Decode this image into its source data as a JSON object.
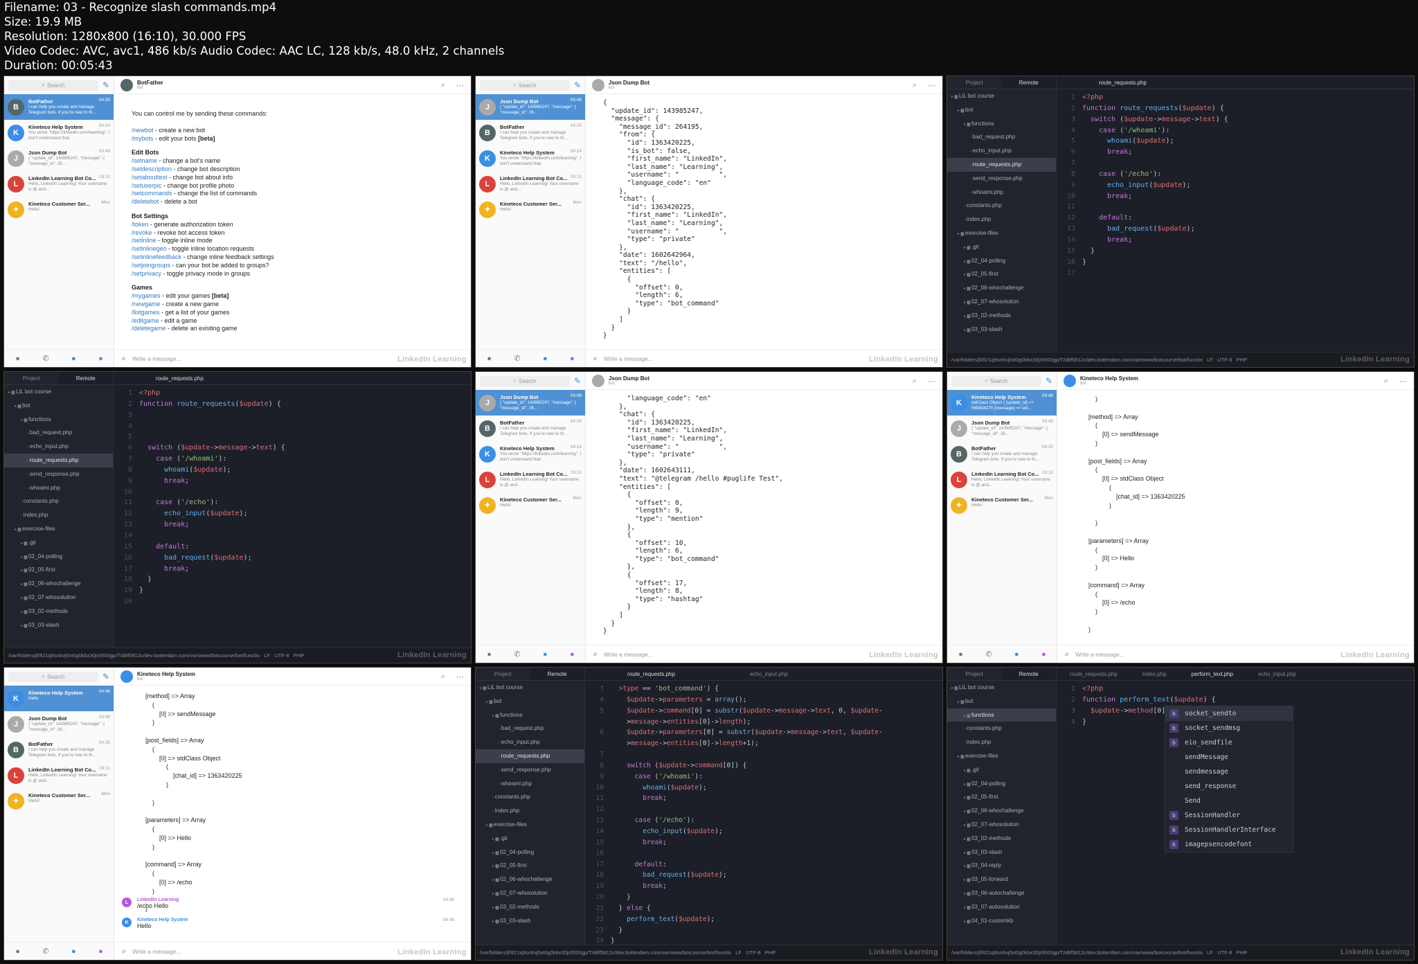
{
  "meta": {
    "filename": "Filename: 03 - Recognize slash commands.mp4",
    "size": "Size: 19.9 MB",
    "resolution": "Resolution: 1280x800 (16:10), 30.000 FPS",
    "video": "Video Codec: AVC, avc1, 486 kb/s Audio Codec: AAC LC, 128 kb/s, 48.0 kHz, 2 channels",
    "duration": "Duration: 00:05:43"
  },
  "common": {
    "search": "Search",
    "write": "Write a message...",
    "watermark": "LinkedIn Learning",
    "project": "Project",
    "remote": "Remote",
    "status_path": "/var/folders/jf/821q9sn6vj0xt0g0kbx30jr0000gp/T/d8f5812c/dev.botterdam.com/var/www/botcourse/bot/functio",
    "status_lf": "LF",
    "status_enc": "UTF-8",
    "status_lang": "PHP"
  },
  "chats": {
    "botfather": {
      "name": "BotFather",
      "preview": "I can help you create and manage Telegram bots. If you're new to th...",
      "time": "04:35"
    },
    "kineteco": {
      "name": "Kineteco Help System",
      "preview": "You wrote \"https://linkedin.com/learning\". I don't understand that.",
      "time": "04:14"
    },
    "jsondump": {
      "name": "Json Dump Bot",
      "preview": "{ \"update_id\": 143985247, \"message\": { \"message_id\": 26...",
      "time": "03:49"
    },
    "linkedin": {
      "name": "LinkedIn Learning Bot Co...",
      "preview": "Hello, LinkedIn Learning! Your username is @ and...",
      "time": "03:11"
    },
    "customer": {
      "name": "Kineteco Customer Ser...",
      "preview": "Hello!",
      "time": "Mon"
    },
    "stdclass": {
      "name": "Kineteco Help System",
      "preview": "stdClass Object ( [update_id] => 565834270 [message] => std...",
      "time": "04:48"
    },
    "hello": {
      "name": "Kineteco Help System",
      "preview": "Hello",
      "time": "04:48"
    }
  },
  "panel1": {
    "title": "BotFather",
    "subtitle": "bot",
    "intro": "You can control me by sending these commands:",
    "line1": [
      "/newbot",
      " - create a new bot"
    ],
    "line2": [
      "/mybots",
      " - edit your bots ",
      "[beta]"
    ],
    "edit_h": "Edit Bots",
    "edit": [
      [
        "/setname",
        " - change a bot's name"
      ],
      [
        "/setdescription",
        " - change bot description"
      ],
      [
        "/setabouttext",
        " - change bot about info"
      ],
      [
        "/setuserpic",
        " - change bot profile photo"
      ],
      [
        "/setcommands",
        " - change the list of commands"
      ],
      [
        "/deletebot",
        " - delete a bot"
      ]
    ],
    "settings_h": "Bot Settings",
    "settings": [
      [
        "/token",
        " - generate authorization token"
      ],
      [
        "/revoke",
        " - revoke bot access token"
      ],
      [
        "/setinline",
        " - toggle inline mode"
      ],
      [
        "/setinlinegeo",
        " - toggle inline location requests"
      ],
      [
        "/setinlinefeedback",
        " - change inline feedback settings"
      ],
      [
        "/setjoingroups",
        " - can your bot be added to groups?"
      ],
      [
        "/setprivacy",
        " - toggle privacy mode in groups"
      ]
    ],
    "games_h": "Games",
    "games": [
      [
        "/mygames",
        " - edit your games ",
        "[beta]"
      ],
      [
        "/newgame",
        " - create a new game"
      ],
      [
        "/listgames",
        " - get a list of your games"
      ],
      [
        "/editgame",
        " - edit a game"
      ],
      [
        "/deletegame",
        " - delete an existing game"
      ]
    ]
  },
  "panel2": {
    "title": "Json Dump Bot",
    "subtitle": "bot",
    "json": "{\n  \"update_id\": 143985247,\n  \"message\": {\n    \"message_id\": 264195,\n    \"from\": {\n      \"id\": 1363420225,\n      \"is_bot\": false,\n      \"first_name\": \"LinkedIn\",\n      \"last_name\": \"Learning\",\n      \"username\": \"          \",\n      \"language_code\": \"en\"\n    },\n    \"chat\": {\n      \"id\": 1363420225,\n      \"first_name\": \"LinkedIn\",\n      \"last_name\": \"Learning\",\n      \"username\": \"          \",\n      \"type\": \"private\"\n    },\n    \"date\": 1602642964,\n    \"text\": \"/hello\",\n    \"entities\": [\n      {\n        \"offset\": 0,\n        \"length\": 6,\n        \"type\": \"bot_command\"\n      }\n    ]\n  }\n}"
  },
  "panel3": {
    "file_tab": "route_requests.php",
    "tree": [
      "LiL bot course",
      "bot",
      "functions",
      "bad_request.php",
      "echo_input.php",
      "route_requests.php",
      "send_response.php",
      "whoami.php",
      "constants.php",
      "index.php",
      "exercise-files",
      ".git",
      "02_04-polling",
      "02_05-first",
      "02_06-whochallenge",
      "02_07-whosolution",
      "03_02-methods",
      "03_03-slash"
    ]
  },
  "panel5": {
    "json": "      \"language_code\": \"en\"\n    },\n    \"chat\": {\n      \"id\": 1363420225,\n      \"first_name\": \"LinkedIn\",\n      \"last_name\": \"Learning\",\n      \"username\": \"          \",\n      \"type\": \"private\"\n    },\n    \"date\": 1602643111,\n    \"text\": \"@telegram /hello #puglife Test\",\n    \"entities\": [\n      {\n        \"offset\": 0,\n        \"length\": 9,\n        \"type\": \"mention\"\n      },\n      {\n        \"offset\": 10,\n        \"length\": 6,\n        \"type\": \"bot_command\"\n      },\n      {\n        \"offset\": 17,\n        \"length\": 8,\n        \"type\": \"hashtag\"\n      }\n    ]\n  }\n}"
  },
  "panel6": {
    "title": "Kineteco Help System",
    "subtitle": "bot",
    "dump": "    )\n\n[method] => Array\n    (\n        [0] => sendMessage\n    )\n\n[post_fields] => Array\n    (\n        [0] => stdClass Object\n            (\n                [chat_id] => 1363420225\n            )\n\n    )\n\n[parameters] => Array\n    (\n        [0] => Hello\n    )\n\n[command] => Array\n    (\n        [0] => /echo\n    )\n\n)"
  },
  "panel7": {
    "dump": "[method] => Array\n    (\n        [0] => sendMessage\n    )\n\n[post_fields] => Array\n    (\n        [0] => stdClass Object\n            (\n                [chat_id] => 1363420225\n            )\n\n    )\n\n[parameters] => Array\n    (\n        [0] => Hello\n    )\n\n[command] => Array\n    (\n        [0] => /echo\n    )\n\n)",
    "msg1_name": "LinkedIn Learning",
    "msg1_text": "/echo Hello",
    "msg1_time": "04:48",
    "msg2_name": "Kineteco Help System",
    "msg2_text": "Hello",
    "msg2_time": "04:48"
  },
  "panel8": {
    "tabs": [
      "route_requests.php",
      "echo_input.php"
    ]
  },
  "panel9": {
    "tabs": [
      "route_requests.php",
      "index.php",
      "perform_text.php",
      "echo_input.php"
    ],
    "tree": [
      "LiL bot course",
      "bot",
      "functions",
      "constants.php",
      "index.php",
      "exercise-files",
      ".git",
      "02_04-polling",
      "02_05-first",
      "02_06-whochallenge",
      "02_07-whosolution",
      "03_02-methods",
      "03_03-slash",
      "03_04-reply",
      "03_05-forward",
      "03_06-autochallenge",
      "03_07-autosolution",
      "04_01-customkb"
    ],
    "suggestions": [
      "socket_sendto",
      "socket_sendmsg",
      "eio_sendfile",
      "sendMessage",
      "sendmessage",
      "send_response",
      "Send",
      "SessionHandler",
      "SessionHandlerInterface",
      "imagepsencodefont"
    ]
  }
}
